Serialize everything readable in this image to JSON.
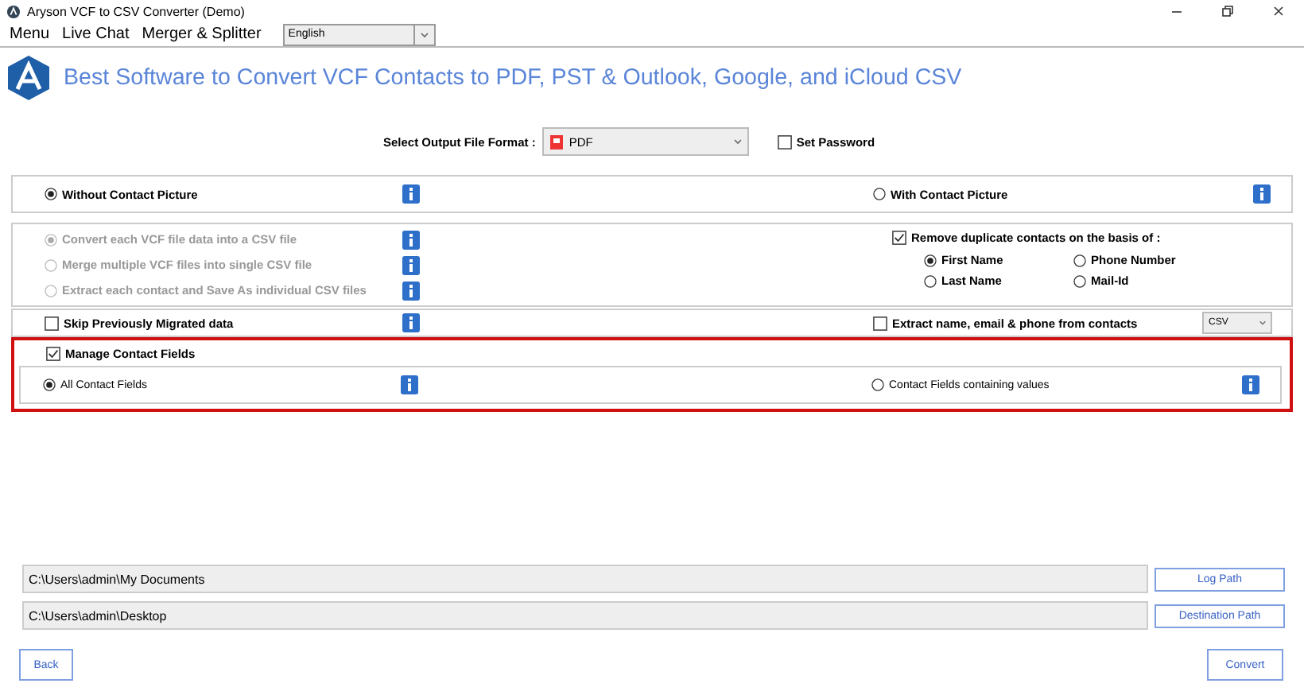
{
  "window": {
    "title": "Aryson VCF to CSV Converter (Demo)"
  },
  "menu": {
    "items": [
      "Menu",
      "Live Chat",
      "Merger & Splitter"
    ],
    "language": "English"
  },
  "header": {
    "title": "Best Software to Convert VCF Contacts to PDF, PST & Outlook, Google, and iCloud CSV"
  },
  "output_format": {
    "label": "Select Output File Format :",
    "value": "PDF",
    "set_password": {
      "label": "Set Password",
      "checked": false
    }
  },
  "picture_options": [
    {
      "label": "Without Contact Picture",
      "selected": true
    },
    {
      "label": "With Contact Picture",
      "selected": false
    }
  ],
  "conversion_modes": [
    {
      "label": "Convert each VCF file data into a CSV file",
      "selected": true,
      "disabled": true
    },
    {
      "label": "Merge multiple VCF files into single CSV file",
      "selected": false,
      "disabled": true
    },
    {
      "label": "Extract each contact and  Save As individual CSV files",
      "selected": false,
      "disabled": true
    }
  ],
  "remove_duplicates": {
    "label": "Remove duplicate contacts on the basis of :",
    "checked": true,
    "options": [
      {
        "label": "First Name",
        "selected": true
      },
      {
        "label": "Phone Number",
        "selected": false
      },
      {
        "label": "Last Name",
        "selected": false
      },
      {
        "label": "Mail-Id",
        "selected": false
      }
    ]
  },
  "skip_migrated": {
    "label": "Skip Previously Migrated data",
    "checked": false
  },
  "extract": {
    "label": "Extract name, email & phone from contacts",
    "checked": false,
    "format": "CSV"
  },
  "manage_fields": {
    "label": "Manage Contact Fields",
    "checked": true,
    "options": [
      {
        "label": "All Contact  Fields",
        "selected": true
      },
      {
        "label": "Contact Fields containing values",
        "selected": false
      }
    ]
  },
  "paths": [
    {
      "value": "C:\\Users\\admin\\My Documents",
      "button": "Log Path"
    },
    {
      "value": "C:\\Users\\admin\\Desktop",
      "button": "Destination Path"
    }
  ],
  "buttons": {
    "back": "Back",
    "convert": "Convert"
  }
}
